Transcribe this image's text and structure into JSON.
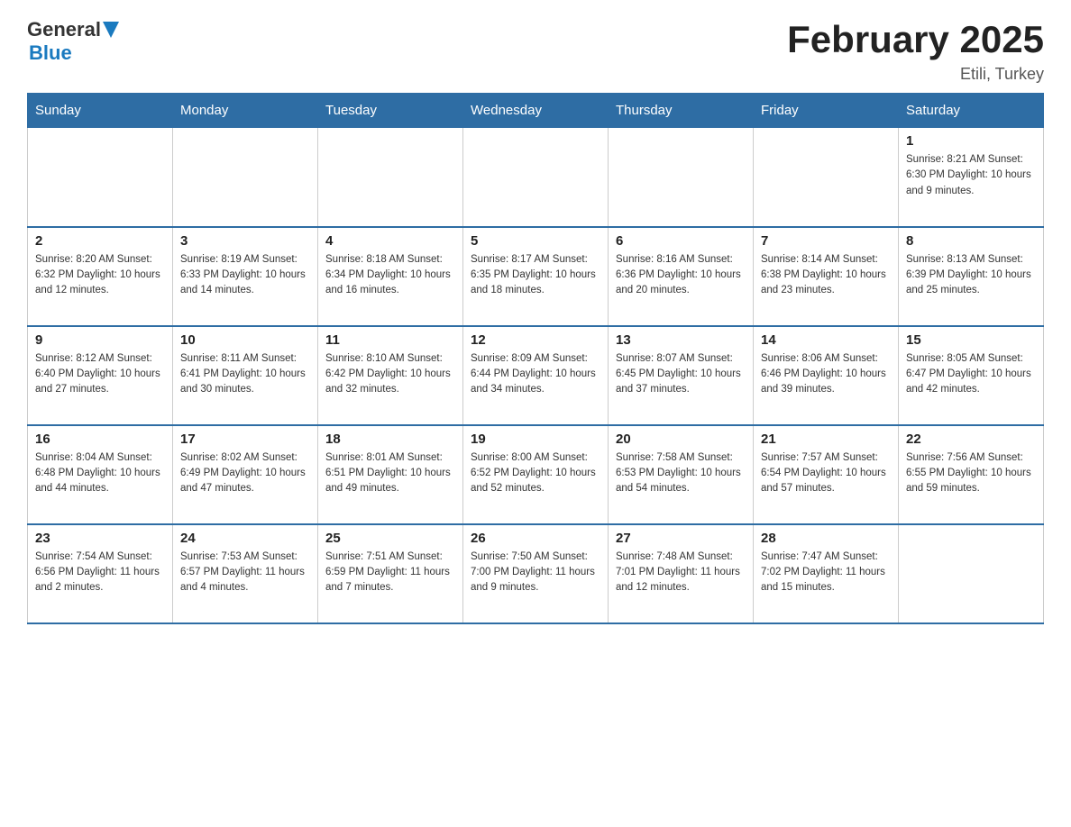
{
  "header": {
    "logo_general": "General",
    "logo_blue": "Blue",
    "month_title": "February 2025",
    "location": "Etili, Turkey"
  },
  "weekdays": [
    "Sunday",
    "Monday",
    "Tuesday",
    "Wednesday",
    "Thursday",
    "Friday",
    "Saturday"
  ],
  "weeks": [
    [
      {
        "day": "",
        "info": ""
      },
      {
        "day": "",
        "info": ""
      },
      {
        "day": "",
        "info": ""
      },
      {
        "day": "",
        "info": ""
      },
      {
        "day": "",
        "info": ""
      },
      {
        "day": "",
        "info": ""
      },
      {
        "day": "1",
        "info": "Sunrise: 8:21 AM\nSunset: 6:30 PM\nDaylight: 10 hours and 9 minutes."
      }
    ],
    [
      {
        "day": "2",
        "info": "Sunrise: 8:20 AM\nSunset: 6:32 PM\nDaylight: 10 hours and 12 minutes."
      },
      {
        "day": "3",
        "info": "Sunrise: 8:19 AM\nSunset: 6:33 PM\nDaylight: 10 hours and 14 minutes."
      },
      {
        "day": "4",
        "info": "Sunrise: 8:18 AM\nSunset: 6:34 PM\nDaylight: 10 hours and 16 minutes."
      },
      {
        "day": "5",
        "info": "Sunrise: 8:17 AM\nSunset: 6:35 PM\nDaylight: 10 hours and 18 minutes."
      },
      {
        "day": "6",
        "info": "Sunrise: 8:16 AM\nSunset: 6:36 PM\nDaylight: 10 hours and 20 minutes."
      },
      {
        "day": "7",
        "info": "Sunrise: 8:14 AM\nSunset: 6:38 PM\nDaylight: 10 hours and 23 minutes."
      },
      {
        "day": "8",
        "info": "Sunrise: 8:13 AM\nSunset: 6:39 PM\nDaylight: 10 hours and 25 minutes."
      }
    ],
    [
      {
        "day": "9",
        "info": "Sunrise: 8:12 AM\nSunset: 6:40 PM\nDaylight: 10 hours and 27 minutes."
      },
      {
        "day": "10",
        "info": "Sunrise: 8:11 AM\nSunset: 6:41 PM\nDaylight: 10 hours and 30 minutes."
      },
      {
        "day": "11",
        "info": "Sunrise: 8:10 AM\nSunset: 6:42 PM\nDaylight: 10 hours and 32 minutes."
      },
      {
        "day": "12",
        "info": "Sunrise: 8:09 AM\nSunset: 6:44 PM\nDaylight: 10 hours and 34 minutes."
      },
      {
        "day": "13",
        "info": "Sunrise: 8:07 AM\nSunset: 6:45 PM\nDaylight: 10 hours and 37 minutes."
      },
      {
        "day": "14",
        "info": "Sunrise: 8:06 AM\nSunset: 6:46 PM\nDaylight: 10 hours and 39 minutes."
      },
      {
        "day": "15",
        "info": "Sunrise: 8:05 AM\nSunset: 6:47 PM\nDaylight: 10 hours and 42 minutes."
      }
    ],
    [
      {
        "day": "16",
        "info": "Sunrise: 8:04 AM\nSunset: 6:48 PM\nDaylight: 10 hours and 44 minutes."
      },
      {
        "day": "17",
        "info": "Sunrise: 8:02 AM\nSunset: 6:49 PM\nDaylight: 10 hours and 47 minutes."
      },
      {
        "day": "18",
        "info": "Sunrise: 8:01 AM\nSunset: 6:51 PM\nDaylight: 10 hours and 49 minutes."
      },
      {
        "day": "19",
        "info": "Sunrise: 8:00 AM\nSunset: 6:52 PM\nDaylight: 10 hours and 52 minutes."
      },
      {
        "day": "20",
        "info": "Sunrise: 7:58 AM\nSunset: 6:53 PM\nDaylight: 10 hours and 54 minutes."
      },
      {
        "day": "21",
        "info": "Sunrise: 7:57 AM\nSunset: 6:54 PM\nDaylight: 10 hours and 57 minutes."
      },
      {
        "day": "22",
        "info": "Sunrise: 7:56 AM\nSunset: 6:55 PM\nDaylight: 10 hours and 59 minutes."
      }
    ],
    [
      {
        "day": "23",
        "info": "Sunrise: 7:54 AM\nSunset: 6:56 PM\nDaylight: 11 hours and 2 minutes."
      },
      {
        "day": "24",
        "info": "Sunrise: 7:53 AM\nSunset: 6:57 PM\nDaylight: 11 hours and 4 minutes."
      },
      {
        "day": "25",
        "info": "Sunrise: 7:51 AM\nSunset: 6:59 PM\nDaylight: 11 hours and 7 minutes."
      },
      {
        "day": "26",
        "info": "Sunrise: 7:50 AM\nSunset: 7:00 PM\nDaylight: 11 hours and 9 minutes."
      },
      {
        "day": "27",
        "info": "Sunrise: 7:48 AM\nSunset: 7:01 PM\nDaylight: 11 hours and 12 minutes."
      },
      {
        "day": "28",
        "info": "Sunrise: 7:47 AM\nSunset: 7:02 PM\nDaylight: 11 hours and 15 minutes."
      },
      {
        "day": "",
        "info": ""
      }
    ]
  ]
}
